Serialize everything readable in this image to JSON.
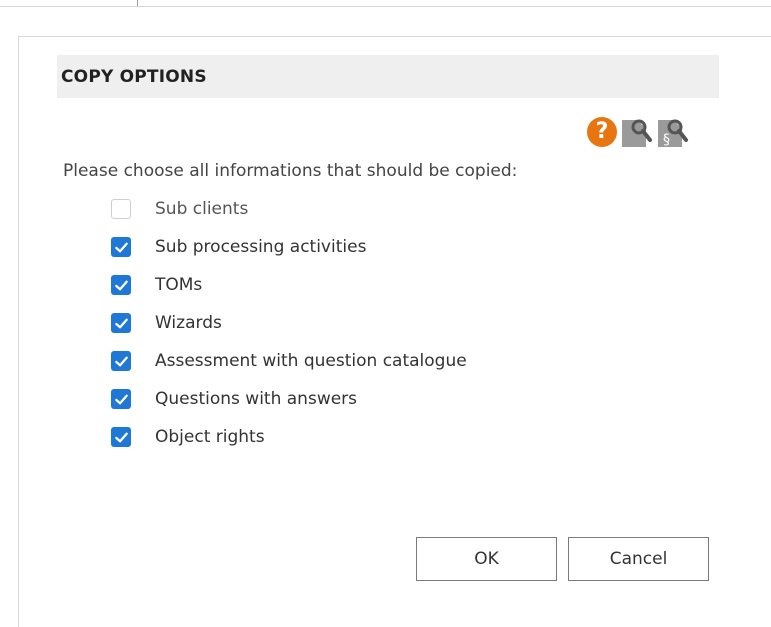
{
  "dialog": {
    "title": "COPY OPTIONS",
    "prompt": "Please choose all informations that should be copied:",
    "options": [
      {
        "label": "Sub clients",
        "checked": false,
        "enabled": false
      },
      {
        "label": "Sub processing activities",
        "checked": true,
        "enabled": true
      },
      {
        "label": "TOMs",
        "checked": true,
        "enabled": true
      },
      {
        "label": "Wizards",
        "checked": true,
        "enabled": true
      },
      {
        "label": "Assessment with question catalogue",
        "checked": true,
        "enabled": true
      },
      {
        "label": "Questions with answers",
        "checked": true,
        "enabled": true
      },
      {
        "label": "Object rights",
        "checked": true,
        "enabled": true
      }
    ],
    "buttons": {
      "ok": "OK",
      "cancel": "Cancel"
    },
    "icons": [
      "help-icon",
      "document-search-icon",
      "paragraph-search-icon"
    ]
  },
  "colors": {
    "accent": "#1f78d6",
    "help": "#e97511",
    "header_bg": "#efefef"
  }
}
